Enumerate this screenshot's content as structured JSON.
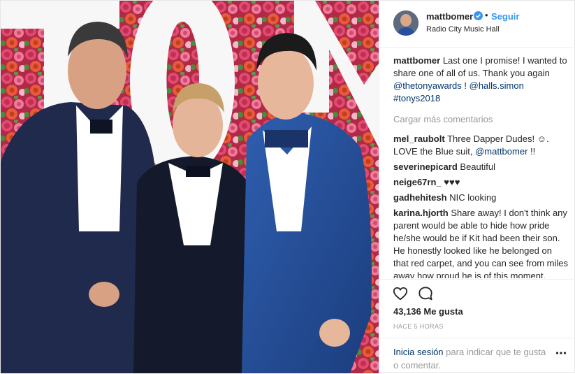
{
  "post": {
    "username": "mattbomer",
    "follow_label": "Seguir",
    "location": "Radio City Music Hall",
    "caption": {
      "user": "mattbomer",
      "text": "Last one I promise! I wanted to share one of all of us. Thank you again",
      "mention1": "@thetonyawards",
      "sep": "!",
      "mention2": "@halls.simon",
      "hashtag": "#tonys2018"
    },
    "load_more": "Cargar más comentarios",
    "comments": [
      {
        "user": "mel_raubolt",
        "text": "Three Dapper Dudes! ☺. LOVE the Blue suit,",
        "mention": "@mattbomer",
        "tail": "!!"
      },
      {
        "user": "severinepicard",
        "text": "Beautiful"
      },
      {
        "user": "neige67rn_",
        "text": "♥♥♥"
      },
      {
        "user": "gadhehitesh",
        "text": "NIC looking"
      },
      {
        "user": "karina.hjorth",
        "text": "Share away! I don't think any parent would be able to hide how pride he/she would be if Kit had been their son. He honestly looked like he belonged on that red carpet, and you can see from miles away how proud he is of this moment. What a way to celebrate becoming a teen (and father's day). It seems like this was a"
      }
    ],
    "likes": "43,136 Me gusta",
    "time": "HACE 5 HORAS",
    "login_link": "Inicia sesión",
    "login_text": "para indicar que te gusta o comentar.",
    "icons": {
      "verified": "verified-badge-icon",
      "like": "heart-outline-icon",
      "comment": "speech-bubble-icon",
      "more": "ellipsis-icon"
    },
    "colors": {
      "link_blue": "#3897f0",
      "mention_blue": "#003569",
      "muted": "#999999",
      "text": "#262626"
    }
  }
}
